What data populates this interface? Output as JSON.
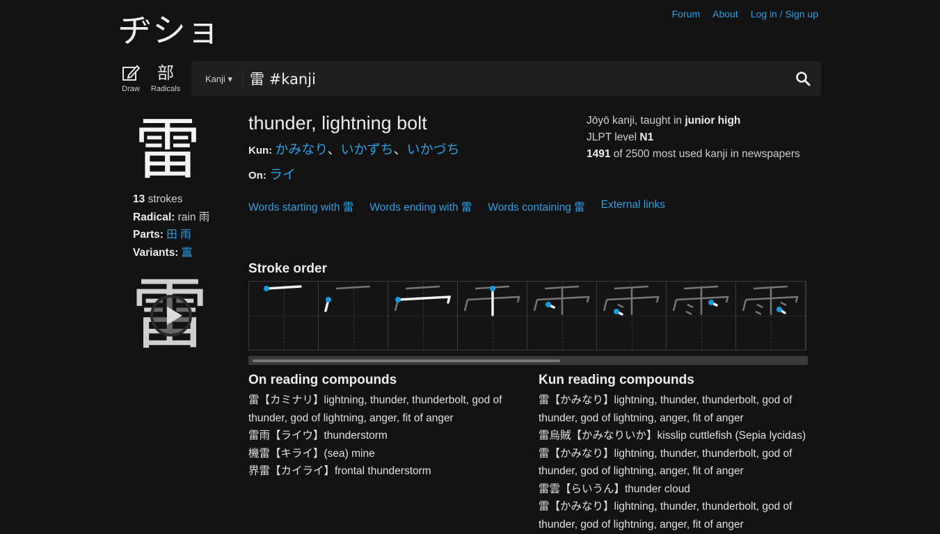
{
  "nav": {
    "forum": "Forum",
    "about": "About",
    "login": "Log in / Sign up"
  },
  "logo": "ヂショ",
  "tools": {
    "draw": {
      "glyph": "✎",
      "label": "Draw"
    },
    "radicals": {
      "glyph": "部",
      "label": "Radicals"
    }
  },
  "search": {
    "mode": "Kanji ▾",
    "query": "雷 #kanji"
  },
  "kanji": {
    "character": "雷",
    "strokes": "13",
    "strokes_label": "strokes",
    "radical_label": "Radical:",
    "radical": "rain 雨",
    "parts_label": "Parts:",
    "parts": [
      "田",
      "雨"
    ],
    "variants_label": "Variants:",
    "variants": "靁",
    "meaning": "thunder, lightning bolt",
    "kun_label": "Kun:",
    "kun": [
      "かみなり",
      "いかずち",
      "いかづち"
    ],
    "on_label": "On:",
    "on": [
      "ライ"
    ],
    "reading_separator": "、"
  },
  "info": {
    "joyo_prefix": "Jōyō kanji, taught in",
    "joyo_grade": "junior high",
    "jlpt_prefix": "JLPT level",
    "jlpt": "N1",
    "freq_rank": "1491",
    "freq_suffix": "of 2500 most used kanji in newspapers"
  },
  "links": {
    "starting": "Words starting with 雷",
    "ending": "Words ending with 雷",
    "containing": "Words containing 雷",
    "external": "External links"
  },
  "stroke_order": {
    "title": "Stroke order"
  },
  "on_compounds": {
    "title": "On reading compounds",
    "items": [
      "雷【カミナリ】lightning, thunder, thunderbolt, god of thunder, god of lightning, anger, fit of anger",
      "雷雨【ライウ】thunderstorm",
      "機雷【キライ】(sea) mine",
      "界雷【カイライ】frontal thunderstorm"
    ]
  },
  "kun_compounds": {
    "title": "Kun reading compounds",
    "items": [
      "雷【かみなり】lightning, thunder, thunderbolt, god of thunder, god of lightning, anger, fit of anger",
      "雷烏賊【かみなりいか】kisslip cuttlefish (Sepia lycidas)",
      "雷【かみなり】lightning, thunder, thunderbolt, god of thunder, god of lightning, anger, fit of anger",
      "雷雲【らいうん】thunder cloud",
      "雷【かみなり】lightning, thunder, thunderbolt, god of thunder, god of lightning, anger, fit of anger"
    ]
  },
  "colors": {
    "accent": "#2d9fe3",
    "background": "#121212",
    "text": "#dcdcdc"
  }
}
